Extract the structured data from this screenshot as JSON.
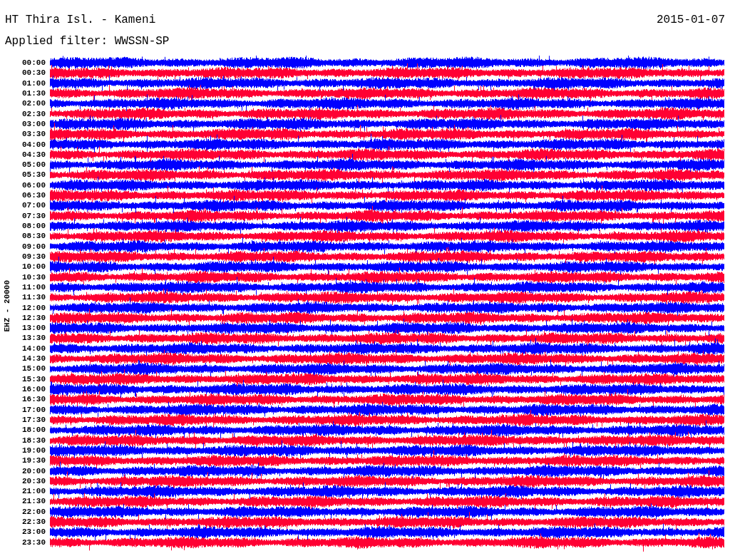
{
  "title": "HT Thira Isl. - Kameni",
  "date": "2015-01-07",
  "filter": "Applied filter: WWSSN-SP",
  "channel_label": "EHZ - 20000",
  "rows": [
    {
      "time": "00:00",
      "color": "#0000ff"
    },
    {
      "time": "00:30",
      "color": "#ff0033"
    },
    {
      "time": "01:00",
      "color": "#0000ff"
    },
    {
      "time": "01:30",
      "color": "#ff0033"
    },
    {
      "time": "02:00",
      "color": "#0000ff"
    },
    {
      "time": "02:30",
      "color": "#ff0033"
    },
    {
      "time": "03:00",
      "color": "#0000ff"
    },
    {
      "time": "03:30",
      "color": "#ff0033"
    },
    {
      "time": "04:00",
      "color": "#0000ff"
    },
    {
      "time": "04:30",
      "color": "#ff0033"
    },
    {
      "time": "05:00",
      "color": "#0000ff"
    },
    {
      "time": "05:30",
      "color": "#ff0033"
    },
    {
      "time": "06:00",
      "color": "#0000ff"
    },
    {
      "time": "06:30",
      "color": "#ff0033"
    },
    {
      "time": "07:00",
      "color": "#0000ff"
    },
    {
      "time": "07:30",
      "color": "#ff0033"
    },
    {
      "time": "08:00",
      "color": "#0000ff"
    },
    {
      "time": "08:30",
      "color": "#ff0033"
    },
    {
      "time": "09:00",
      "color": "#0000ff"
    },
    {
      "time": "09:30",
      "color": "#ff0033"
    },
    {
      "time": "10:00",
      "color": "#0000ff"
    },
    {
      "time": "10:30",
      "color": "#ff0033"
    },
    {
      "time": "11:00",
      "color": "#0000ff"
    },
    {
      "time": "11:30",
      "color": "#ff0033"
    },
    {
      "time": "12:00",
      "color": "#0000ff"
    },
    {
      "time": "12:30",
      "color": "#ff0033"
    },
    {
      "time": "13:00",
      "color": "#0000ff"
    },
    {
      "time": "13:30",
      "color": "#ff0033"
    },
    {
      "time": "14:00",
      "color": "#0000ff"
    },
    {
      "time": "14:30",
      "color": "#ff0033"
    },
    {
      "time": "15:00",
      "color": "#0000ff"
    },
    {
      "time": "15:30",
      "color": "#ff0033"
    },
    {
      "time": "16:00",
      "color": "#0000ff"
    },
    {
      "time": "16:30",
      "color": "#ff0033"
    },
    {
      "time": "17:00",
      "color": "#0000ff"
    },
    {
      "time": "17:30",
      "color": "#ff0033"
    },
    {
      "time": "18:00",
      "color": "#0000ff"
    },
    {
      "time": "18:30",
      "color": "#ff0033"
    },
    {
      "time": "19:00",
      "color": "#0000ff"
    },
    {
      "time": "19:30",
      "color": "#ff0033"
    },
    {
      "time": "20:00",
      "color": "#0000ff"
    },
    {
      "time": "20:30",
      "color": "#ff0033"
    },
    {
      "time": "21:00",
      "color": "#0000ff"
    },
    {
      "time": "21:30",
      "color": "#ff0033"
    },
    {
      "time": "22:00",
      "color": "#0000ff"
    },
    {
      "time": "22:30",
      "color": "#ff0033"
    },
    {
      "time": "23:00",
      "color": "#0000ff"
    },
    {
      "time": "23:30",
      "color": "#ff0033"
    }
  ]
}
